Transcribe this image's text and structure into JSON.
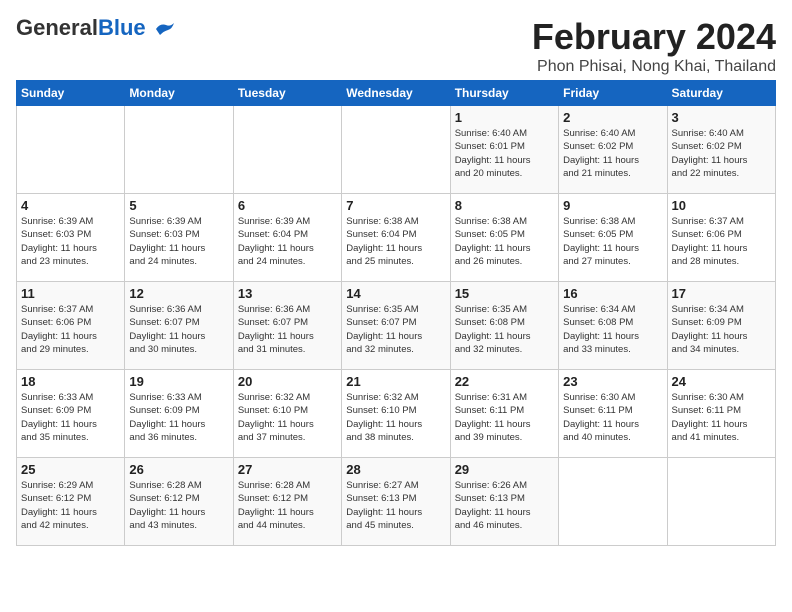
{
  "header": {
    "logo_general": "General",
    "logo_blue": "Blue",
    "month_title": "February 2024",
    "location": "Phon Phisai, Nong Khai, Thailand"
  },
  "days_of_week": [
    "Sunday",
    "Monday",
    "Tuesday",
    "Wednesday",
    "Thursday",
    "Friday",
    "Saturday"
  ],
  "weeks": [
    [
      {
        "day": "",
        "info": ""
      },
      {
        "day": "",
        "info": ""
      },
      {
        "day": "",
        "info": ""
      },
      {
        "day": "",
        "info": ""
      },
      {
        "day": "1",
        "info": "Sunrise: 6:40 AM\nSunset: 6:01 PM\nDaylight: 11 hours\nand 20 minutes."
      },
      {
        "day": "2",
        "info": "Sunrise: 6:40 AM\nSunset: 6:02 PM\nDaylight: 11 hours\nand 21 minutes."
      },
      {
        "day": "3",
        "info": "Sunrise: 6:40 AM\nSunset: 6:02 PM\nDaylight: 11 hours\nand 22 minutes."
      }
    ],
    [
      {
        "day": "4",
        "info": "Sunrise: 6:39 AM\nSunset: 6:03 PM\nDaylight: 11 hours\nand 23 minutes."
      },
      {
        "day": "5",
        "info": "Sunrise: 6:39 AM\nSunset: 6:03 PM\nDaylight: 11 hours\nand 24 minutes."
      },
      {
        "day": "6",
        "info": "Sunrise: 6:39 AM\nSunset: 6:04 PM\nDaylight: 11 hours\nand 24 minutes."
      },
      {
        "day": "7",
        "info": "Sunrise: 6:38 AM\nSunset: 6:04 PM\nDaylight: 11 hours\nand 25 minutes."
      },
      {
        "day": "8",
        "info": "Sunrise: 6:38 AM\nSunset: 6:05 PM\nDaylight: 11 hours\nand 26 minutes."
      },
      {
        "day": "9",
        "info": "Sunrise: 6:38 AM\nSunset: 6:05 PM\nDaylight: 11 hours\nand 27 minutes."
      },
      {
        "day": "10",
        "info": "Sunrise: 6:37 AM\nSunset: 6:06 PM\nDaylight: 11 hours\nand 28 minutes."
      }
    ],
    [
      {
        "day": "11",
        "info": "Sunrise: 6:37 AM\nSunset: 6:06 PM\nDaylight: 11 hours\nand 29 minutes."
      },
      {
        "day": "12",
        "info": "Sunrise: 6:36 AM\nSunset: 6:07 PM\nDaylight: 11 hours\nand 30 minutes."
      },
      {
        "day": "13",
        "info": "Sunrise: 6:36 AM\nSunset: 6:07 PM\nDaylight: 11 hours\nand 31 minutes."
      },
      {
        "day": "14",
        "info": "Sunrise: 6:35 AM\nSunset: 6:07 PM\nDaylight: 11 hours\nand 32 minutes."
      },
      {
        "day": "15",
        "info": "Sunrise: 6:35 AM\nSunset: 6:08 PM\nDaylight: 11 hours\nand 32 minutes."
      },
      {
        "day": "16",
        "info": "Sunrise: 6:34 AM\nSunset: 6:08 PM\nDaylight: 11 hours\nand 33 minutes."
      },
      {
        "day": "17",
        "info": "Sunrise: 6:34 AM\nSunset: 6:09 PM\nDaylight: 11 hours\nand 34 minutes."
      }
    ],
    [
      {
        "day": "18",
        "info": "Sunrise: 6:33 AM\nSunset: 6:09 PM\nDaylight: 11 hours\nand 35 minutes."
      },
      {
        "day": "19",
        "info": "Sunrise: 6:33 AM\nSunset: 6:09 PM\nDaylight: 11 hours\nand 36 minutes."
      },
      {
        "day": "20",
        "info": "Sunrise: 6:32 AM\nSunset: 6:10 PM\nDaylight: 11 hours\nand 37 minutes."
      },
      {
        "day": "21",
        "info": "Sunrise: 6:32 AM\nSunset: 6:10 PM\nDaylight: 11 hours\nand 38 minutes."
      },
      {
        "day": "22",
        "info": "Sunrise: 6:31 AM\nSunset: 6:11 PM\nDaylight: 11 hours\nand 39 minutes."
      },
      {
        "day": "23",
        "info": "Sunrise: 6:30 AM\nSunset: 6:11 PM\nDaylight: 11 hours\nand 40 minutes."
      },
      {
        "day": "24",
        "info": "Sunrise: 6:30 AM\nSunset: 6:11 PM\nDaylight: 11 hours\nand 41 minutes."
      }
    ],
    [
      {
        "day": "25",
        "info": "Sunrise: 6:29 AM\nSunset: 6:12 PM\nDaylight: 11 hours\nand 42 minutes."
      },
      {
        "day": "26",
        "info": "Sunrise: 6:28 AM\nSunset: 6:12 PM\nDaylight: 11 hours\nand 43 minutes."
      },
      {
        "day": "27",
        "info": "Sunrise: 6:28 AM\nSunset: 6:12 PM\nDaylight: 11 hours\nand 44 minutes."
      },
      {
        "day": "28",
        "info": "Sunrise: 6:27 AM\nSunset: 6:13 PM\nDaylight: 11 hours\nand 45 minutes."
      },
      {
        "day": "29",
        "info": "Sunrise: 6:26 AM\nSunset: 6:13 PM\nDaylight: 11 hours\nand 46 minutes."
      },
      {
        "day": "",
        "info": ""
      },
      {
        "day": "",
        "info": ""
      }
    ]
  ],
  "colors": {
    "header_bg": "#1565c0",
    "header_text": "#ffffff",
    "border": "#cccccc",
    "row_odd": "#f9f9f9",
    "row_even": "#ffffff"
  }
}
